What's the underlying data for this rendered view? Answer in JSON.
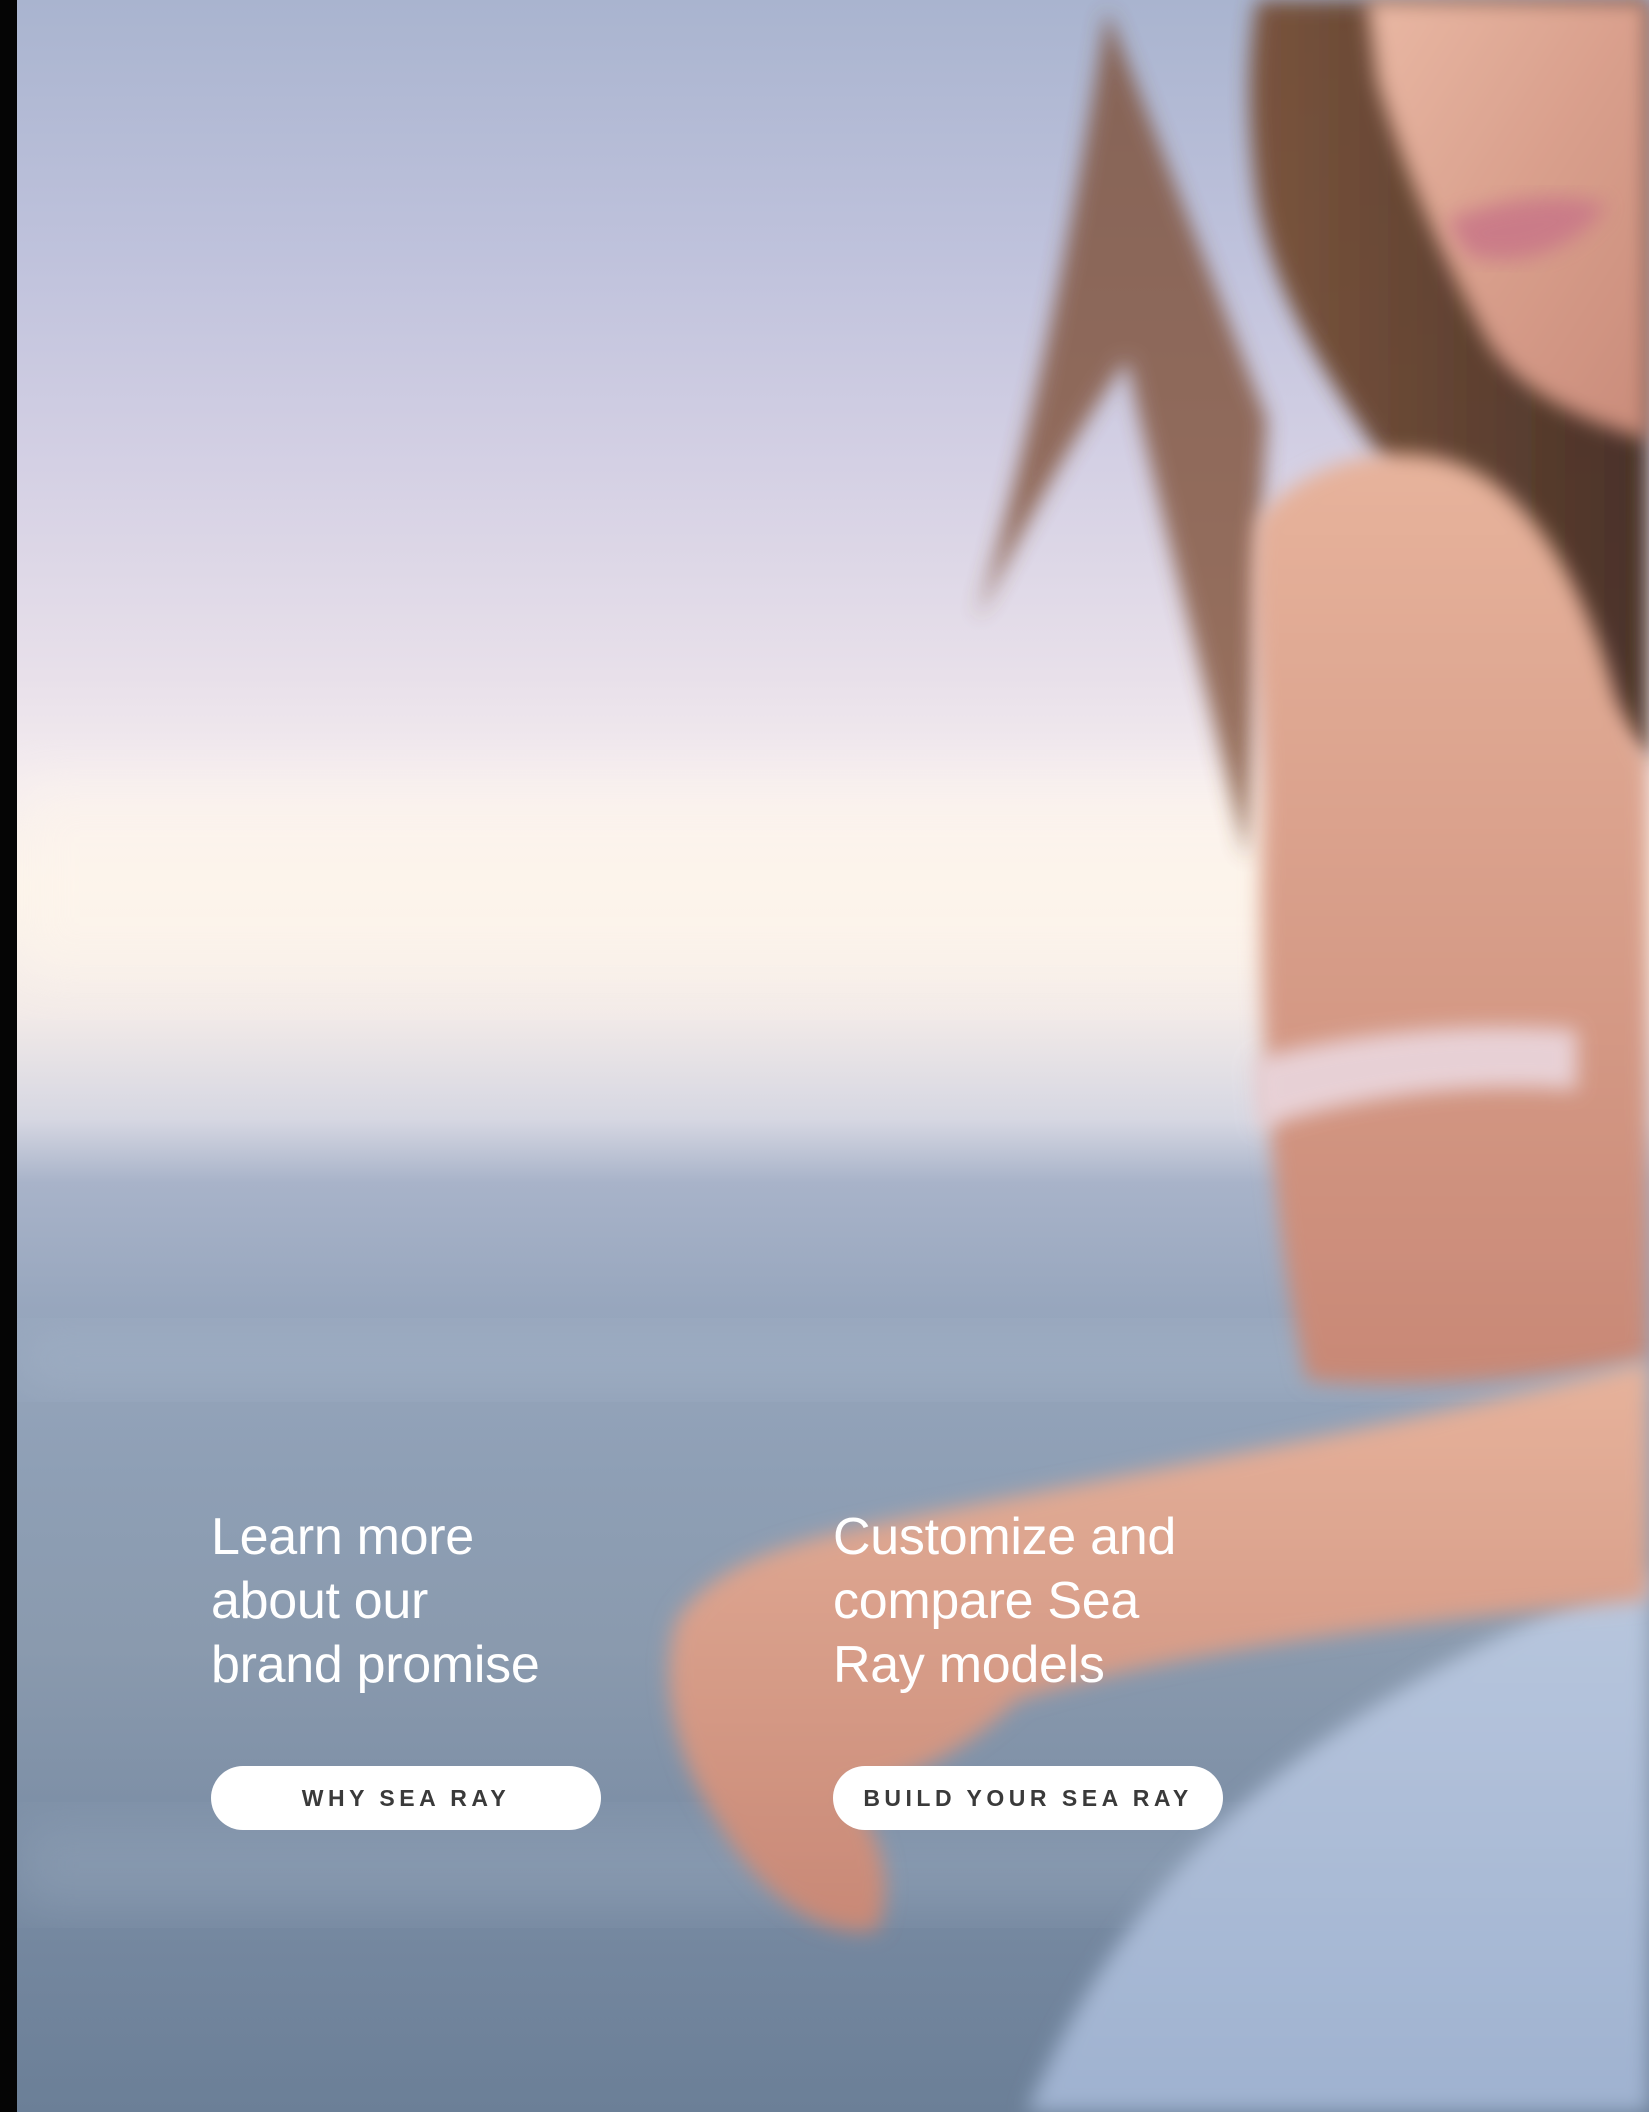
{
  "colors": {
    "button_background": "#ffffff",
    "button_text": "#3a3a3a",
    "heading_text": "#ffffff"
  },
  "cta": [
    {
      "heading_lines": [
        "Learn more",
        "about our",
        "brand promise"
      ],
      "button_label": "WHY SEA RAY"
    },
    {
      "heading_lines": [
        "Customize and",
        "compare Sea",
        "Ray models"
      ],
      "button_label": "BUILD YOUR SEA RAY"
    }
  ]
}
